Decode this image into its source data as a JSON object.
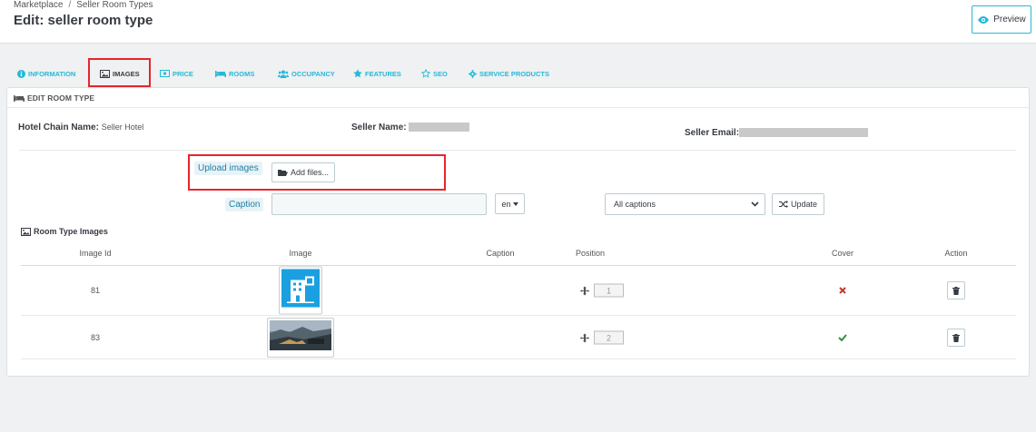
{
  "breadcrumb": [
    "Marketplace",
    "Seller Room Types"
  ],
  "page_title": "Edit: seller room type",
  "preview_label": "Preview",
  "tabs": [
    {
      "label": "Information",
      "icon": "info-icon",
      "active": false
    },
    {
      "label": "Images",
      "icon": "image-icon",
      "active": true
    },
    {
      "label": "Price",
      "icon": "money-icon",
      "active": false
    },
    {
      "label": "Rooms",
      "icon": "bed-icon",
      "active": false
    },
    {
      "label": "Occupancy",
      "icon": "users-icon",
      "active": false
    },
    {
      "label": "Features",
      "icon": "star-icon",
      "active": false
    },
    {
      "label": "SEO",
      "icon": "star-outline-icon",
      "active": false
    },
    {
      "label": "Service Products",
      "icon": "gear-icon",
      "active": false
    }
  ],
  "panel": {
    "title": "EDIT ROOM TYPE",
    "hotel_chain_label": "Hotel Chain Name:",
    "hotel_chain_value": "Seller Hotel",
    "seller_name_label": "Seller Name:",
    "seller_email_label": "Seller Email:"
  },
  "upload": {
    "label": "Upload images",
    "add_files": "Add files..."
  },
  "caption": {
    "label": "Caption",
    "value": "",
    "lang": "en",
    "select_value": "All captions",
    "update_label": "Update"
  },
  "images_section": {
    "title": "Room Type Images",
    "columns": [
      "Image Id",
      "Image",
      "Caption",
      "Position",
      "Cover",
      "Action"
    ],
    "rows": [
      {
        "id": "81",
        "caption": "",
        "position": "1",
        "cover": false
      },
      {
        "id": "83",
        "caption": "",
        "position": "2",
        "cover": true
      }
    ]
  },
  "colors": {
    "accent": "#25b9d7",
    "highlight": "#e5262b",
    "cover_false": "#c0392b",
    "cover_true": "#3a8c3f"
  }
}
